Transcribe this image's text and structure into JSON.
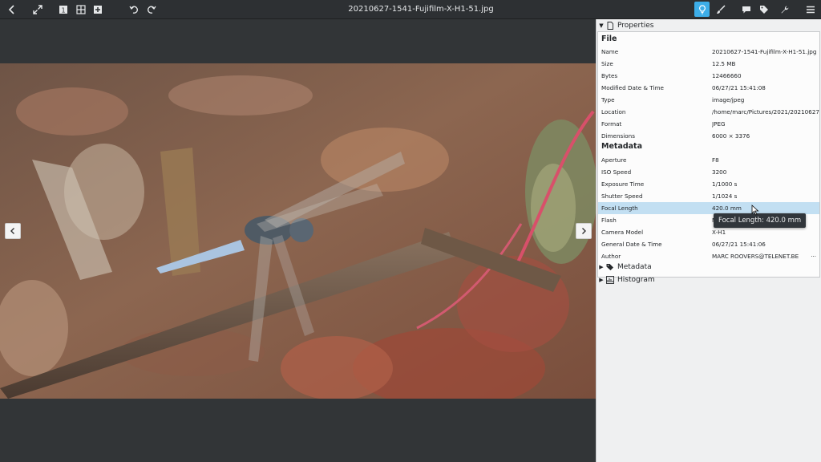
{
  "window": {
    "title": "20210627-1541-Fujifilm-X-H1-51.jpg"
  },
  "toolbar": {
    "left": [
      {
        "name": "back-icon"
      },
      {
        "name": "fullscreen-icon"
      },
      {
        "name": "view-single-icon",
        "text": "1"
      },
      {
        "name": "view-grid-icon"
      },
      {
        "name": "add-icon"
      },
      {
        "name": "rotate-left-icon"
      },
      {
        "name": "rotate-right-icon"
      }
    ],
    "right": [
      {
        "name": "info-icon",
        "active": true
      },
      {
        "name": "brush-icon"
      },
      {
        "name": "comment-icon"
      },
      {
        "name": "tag-icon"
      },
      {
        "name": "tools-icon"
      },
      {
        "name": "hamburger-menu-icon"
      }
    ]
  },
  "panel": {
    "properties_header": "Properties",
    "file": {
      "title": "File",
      "rows": [
        {
          "key": "Name",
          "value": "20210627-1541-Fujifilm-X-H1-51.jpg"
        },
        {
          "key": "Size",
          "value": "12.5 MB"
        },
        {
          "key": "Bytes",
          "value": "12466660"
        },
        {
          "key": "Modified Date & Time",
          "value": "06/27/21 15:41:08"
        },
        {
          "key": "Type",
          "value": "image/jpeg"
        },
        {
          "key": "Location",
          "value": "/home/marc/Pictures/2021/20210627 ..."
        },
        {
          "key": "Format",
          "value": "JPEG"
        },
        {
          "key": "Dimensions",
          "value": "6000 × 3376"
        }
      ]
    },
    "metadata": {
      "title": "Metadata",
      "rows": [
        {
          "key": "Aperture",
          "value": "F8"
        },
        {
          "key": "ISO Speed",
          "value": "3200"
        },
        {
          "key": "Exposure Time",
          "value": "1/1000 s"
        },
        {
          "key": "Shutter Speed",
          "value": "1/1024 s"
        },
        {
          "key": "Focal Length",
          "value": "420.0 mm",
          "selected": true
        },
        {
          "key": "Flash",
          "value": "N"
        },
        {
          "key": "Camera Model",
          "value": "X-H1"
        },
        {
          "key": "General Date & Time",
          "value": "06/27/21 15:41:06"
        },
        {
          "key": "Author",
          "value": "MARC ROOVERS@TELENET.BE",
          "more": "..."
        }
      ]
    },
    "metadata_header": "Metadata",
    "histogram_header": "Histogram"
  },
  "tooltip": {
    "text": "Focal Length: 420.0 mm"
  },
  "colors": {
    "toolbar_bg": "#2d3033",
    "viewer_bg": "#323537",
    "accent": "#3daee9",
    "selection": "#c2dff2"
  }
}
